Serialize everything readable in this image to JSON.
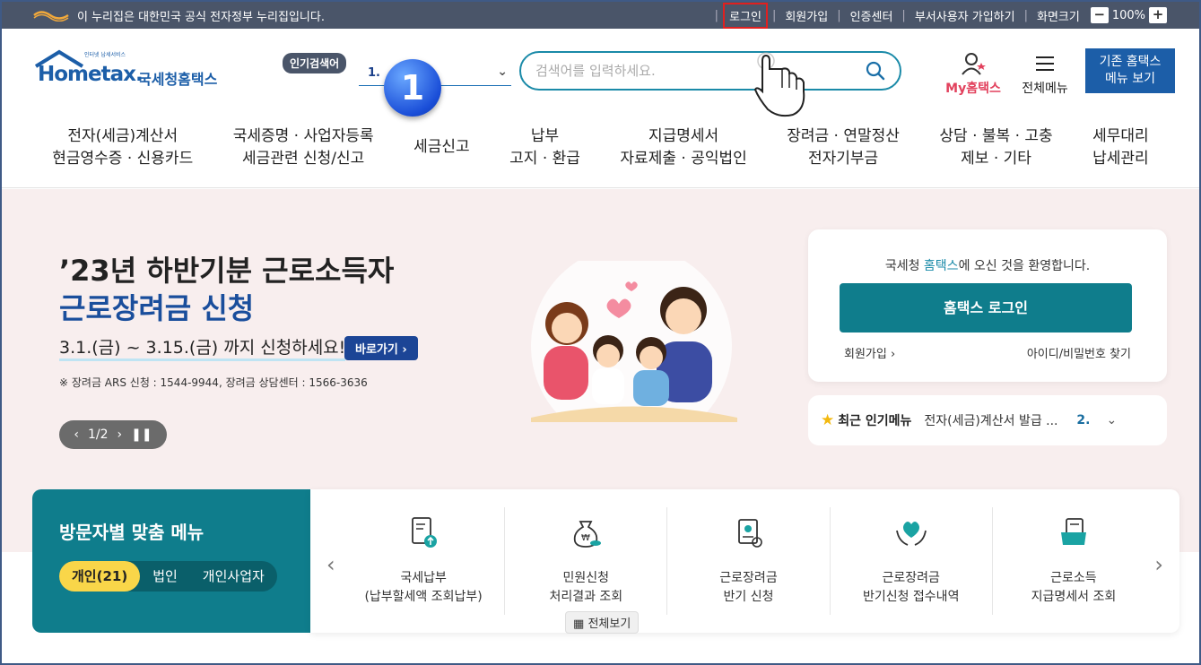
{
  "govbar": {
    "notice": "이 누리집은 대한민국 공식 전자정부 누리집입니다.",
    "links": [
      "로그인",
      "회원가입",
      "인증센터",
      "부서사용자 가입하기",
      "화면크기"
    ],
    "zoom_minus": "−",
    "zoom_value": "100%",
    "zoom_plus": "+"
  },
  "header": {
    "logo_text": "Hometax.",
    "logo_small": "인터넷 납세서비스",
    "logo_kr": "국세청홈택스",
    "popular_label": "인기검색어",
    "popular_value": "1.",
    "step_badge": "1",
    "search_placeholder": "검색어를 입력하세요.",
    "my_label_prefix": "My",
    "my_label_suffix": "홈택스",
    "all_menu": "전체메뉴",
    "old_home_line1": "기존 홈택스",
    "old_home_line2": "메뉴 보기"
  },
  "gnb": [
    {
      "l1": "전자(세금)계산서",
      "l2": "현금영수증 · 신용카드"
    },
    {
      "l1": "국세증명 · 사업자등록",
      "l2": "세금관련 신청/신고"
    },
    {
      "l1": "세금신고",
      "l2": ""
    },
    {
      "l1": "납부",
      "l2": "고지 · 환급"
    },
    {
      "l1": "지급명세서",
      "l2": "자료제출 · 공익법인"
    },
    {
      "l1": "장려금 · 연말정산",
      "l2": "전자기부금"
    },
    {
      "l1": "상담 · 불복 · 고충",
      "l2": "제보 · 기타"
    },
    {
      "l1": "세무대리",
      "l2": "납세관리"
    }
  ],
  "hero": {
    "title1": "’23년 하반기분 근로소득자",
    "title2": "근로장려금 신청",
    "period": "3.1.(금) ~ 3.15.(금) 까지 신청하세요!",
    "go_button": "바로가기 ›",
    "note": "※ 장려금 ARS 신청 : 1544-9944, 장려금 상담센터 : 1566-3636",
    "pager": "1/2"
  },
  "login_card": {
    "welcome_prefix": "국세청 ",
    "welcome_brand": "홈택스",
    "welcome_suffix": "에 오신 것을 환영합니다.",
    "login_button": "홈택스 로그인",
    "join": "회원가입 ›",
    "find_id": "아이디/비밀번호 찾기"
  },
  "popular_menu": {
    "title": "최근 인기메뉴",
    "item": "전자(세금)계산서 발급 ...",
    "next_num": "2."
  },
  "visitor_menu": {
    "title": "방문자별 맞춤 메뉴",
    "tabs": [
      "개인(21)",
      "법인",
      "개인사업자"
    ]
  },
  "quick_menu": {
    "items": [
      {
        "l1": "국세납부",
        "l2": "(납부할세액 조회납부)"
      },
      {
        "l1": "민원신청",
        "l2": "처리결과 조회"
      },
      {
        "l1": "근로장려금",
        "l2": "반기 신청"
      },
      {
        "l1": "근로장려금",
        "l2": "반기신청 접수내역"
      },
      {
        "l1": "근로소득",
        "l2": "지급명세서 조회"
      }
    ],
    "view_all": "전체보기"
  },
  "colors": {
    "primary_teal": "#0f7d8c",
    "gov_bar": "#4a5569",
    "brand_blue": "#1c5ea8",
    "highlight_red": "#e02020"
  }
}
